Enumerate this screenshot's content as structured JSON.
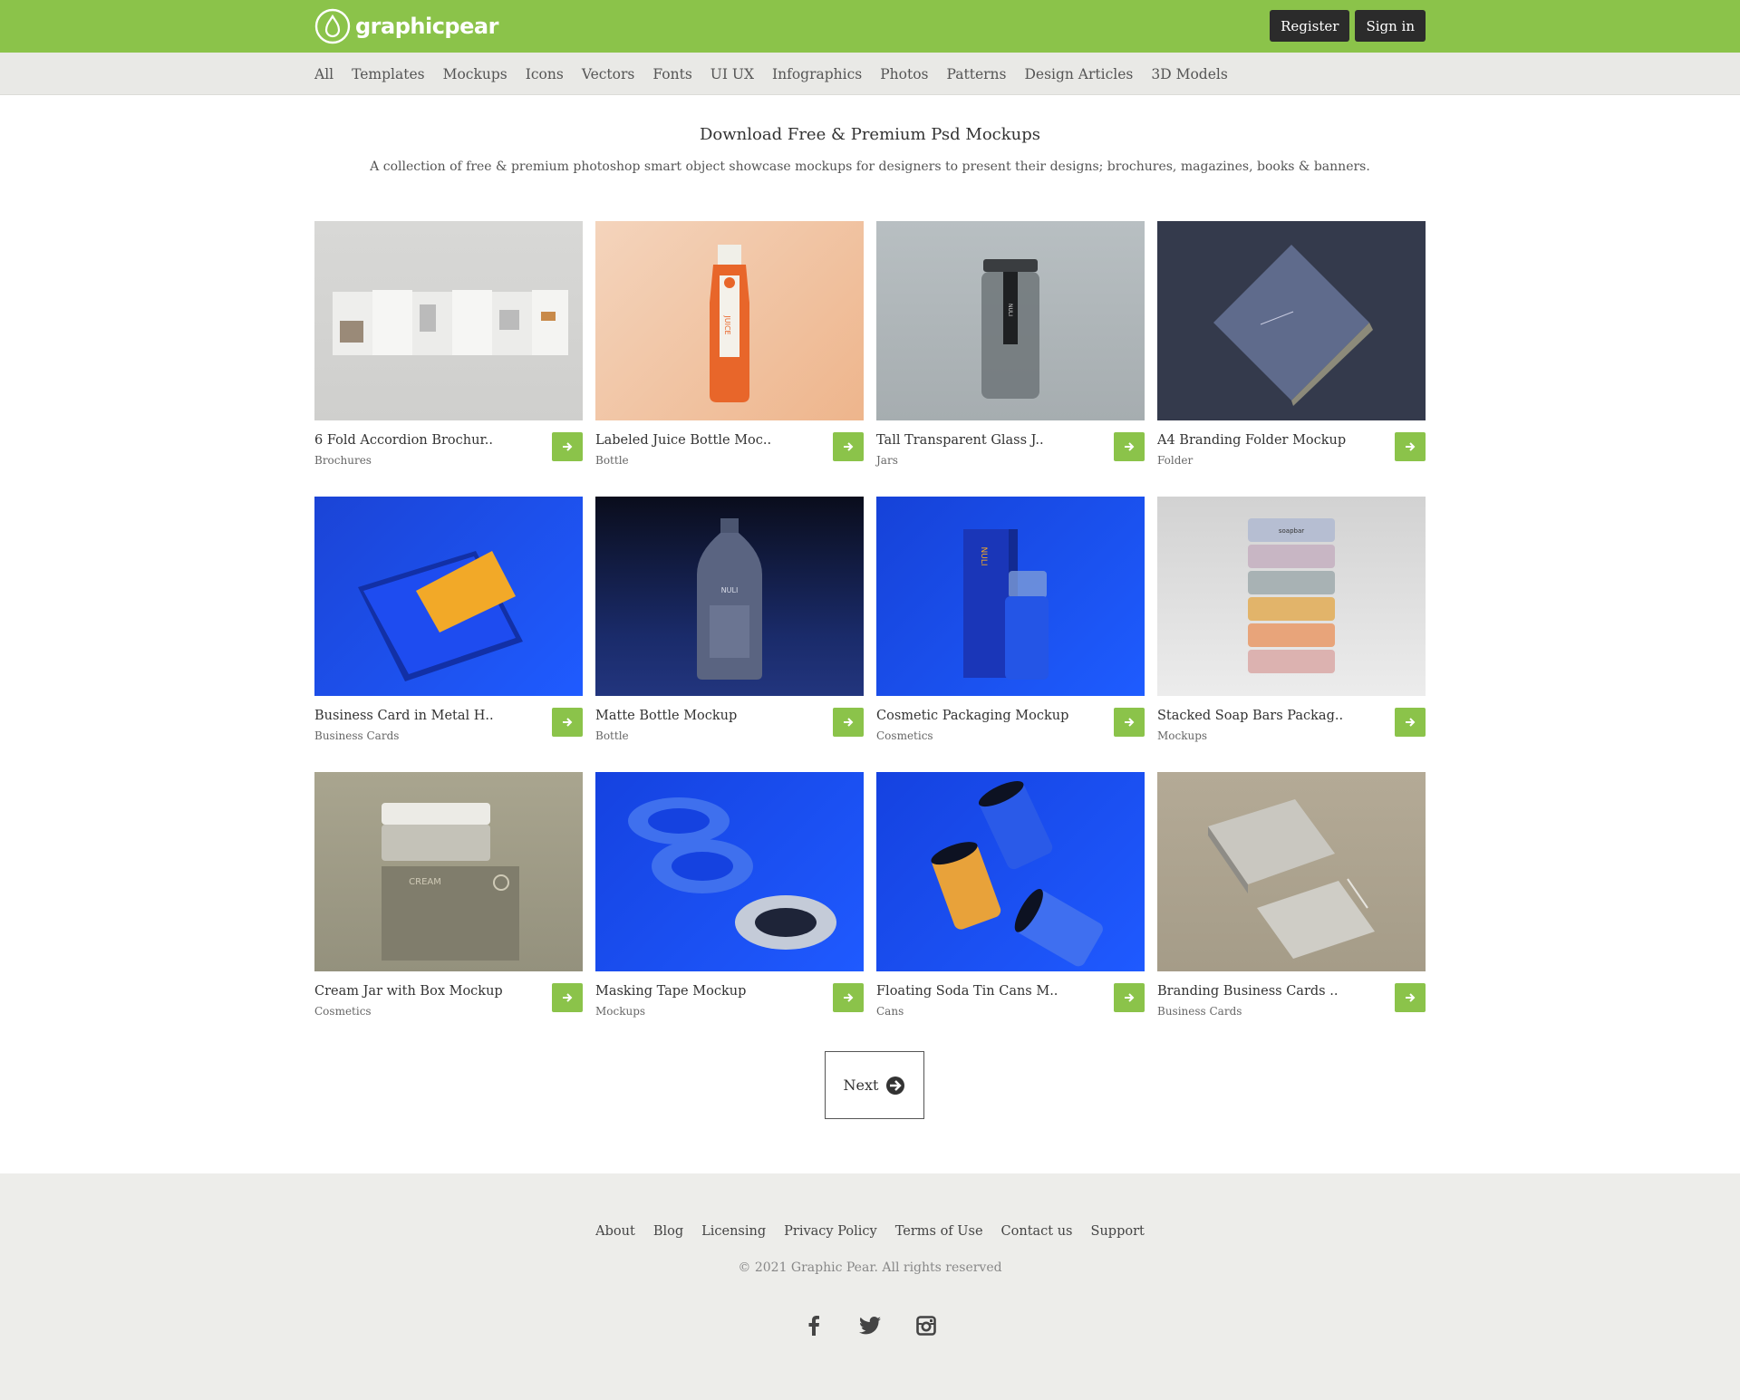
{
  "brand": {
    "name": "graphicpear",
    "accent": "#8bc34a"
  },
  "auth": {
    "register": "Register",
    "signin": "Sign in"
  },
  "nav": [
    "All",
    "Templates",
    "Mockups",
    "Icons",
    "Vectors",
    "Fonts",
    "UI UX",
    "Infographics",
    "Photos",
    "Patterns",
    "Design Articles",
    "3D Models"
  ],
  "intro": {
    "title": "Download Free & Premium Psd Mockups",
    "subtitle": "A collection of free & premium photoshop smart object showcase mockups for designers to present their designs; brochures, magazines, books & banners."
  },
  "cards": [
    {
      "title": "6 Fold Accordion Brochur..",
      "category": "Brochures"
    },
    {
      "title": "Labeled Juice Bottle Moc..",
      "category": "Bottle"
    },
    {
      "title": "Tall Transparent Glass J..",
      "category": "Jars"
    },
    {
      "title": "A4 Branding Folder Mockup",
      "category": "Folder"
    },
    {
      "title": "Business Card in Metal H..",
      "category": "Business Cards"
    },
    {
      "title": "Matte Bottle Mockup",
      "category": "Bottle"
    },
    {
      "title": "Cosmetic Packaging Mockup",
      "category": "Cosmetics"
    },
    {
      "title": "Stacked Soap Bars Packag..",
      "category": "Mockups"
    },
    {
      "title": "Cream Jar with Box Mockup",
      "category": "Cosmetics"
    },
    {
      "title": "Masking Tape Mockup",
      "category": "Mockups"
    },
    {
      "title": "Floating Soda Tin Cans M..",
      "category": "Cans"
    },
    {
      "title": "Branding Business Cards ..",
      "category": "Business Cards"
    }
  ],
  "thumb_text": {
    "juice": "JUICE",
    "nuli": "NULI",
    "soap": "soapbar",
    "cream": "CREAM"
  },
  "pagination": {
    "next": "Next"
  },
  "footer": {
    "links": [
      "About",
      "Blog",
      "Licensing",
      "Privacy Policy",
      "Terms of Use",
      "Contact us",
      "Support"
    ],
    "copyright": "© 2021 Graphic Pear. All rights reserved",
    "socials": [
      "facebook-icon",
      "twitter-icon",
      "instagram-icon"
    ]
  }
}
